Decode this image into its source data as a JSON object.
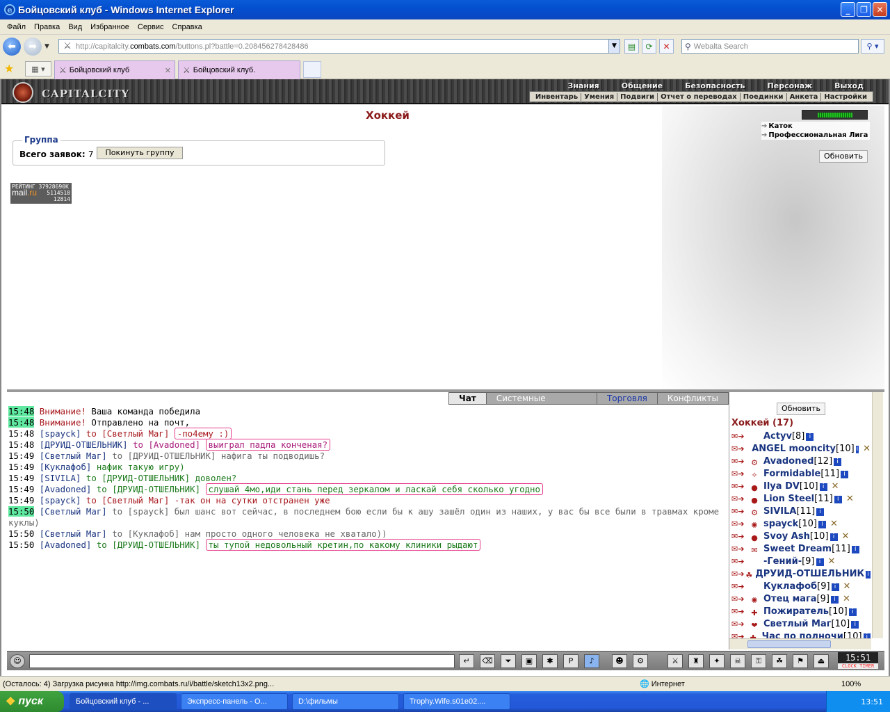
{
  "window": {
    "title": "Бойцовский клуб - Windows Internet Explorer"
  },
  "menu": [
    "Файл",
    "Правка",
    "Вид",
    "Избранное",
    "Сервис",
    "Справка"
  ],
  "address": {
    "host_prefix": "http://capitalcity.",
    "host": "combats.com",
    "path": "/buttons.pl?battle=0.208456278428486"
  },
  "search": {
    "placeholder": "Webalta Search"
  },
  "tabs": [
    {
      "label": "Бойцовский клуб"
    },
    {
      "label": "Бойцовский клуб."
    }
  ],
  "game": {
    "brand": "CAPITALCITY",
    "topnav": [
      "Знания",
      "Общение",
      "Безопасность",
      "Персонаж",
      "Выход"
    ],
    "subnav": [
      "Инвентарь",
      "Умения",
      "Подвиги",
      "Отчет о переводах",
      "Поединки",
      "Анкета",
      "Настройки"
    ],
    "title": "Хоккей",
    "group_label": "Группа",
    "total_label": "Всего заявок:",
    "total_count": "7",
    "leave_button": "Покинуть группу",
    "rating": {
      "line1": "РЕЙТИНГ 37928690К",
      "line2": "5114518",
      "line3": "12814",
      "mail": "mail",
      "ru": ".ru"
    },
    "energy_fraction": 0.72,
    "links": [
      "Каток",
      "Профессиональная Лига"
    ],
    "refresh": "Обновить"
  },
  "chat": {
    "tabs": [
      "Чат",
      "Системные сообщения",
      "Торговля",
      "Конфликты"
    ],
    "lines": [
      {
        "ts": "15:48",
        "hl": true,
        "parts": [
          {
            "t": "Внимание!",
            "c": "warn"
          },
          {
            "t": " Ваша команда победила",
            "c": ""
          }
        ]
      },
      {
        "ts": "15:48",
        "hl": true,
        "parts": [
          {
            "t": "Внимание!",
            "c": "warn"
          },
          {
            "t": " Отправлено на почт,",
            "c": ""
          }
        ]
      },
      {
        "ts": "15:48",
        "hl": false,
        "parts": [
          {
            "t": "[spayck]",
            "c": "nm"
          },
          {
            "t": " to [Светлый Маг] ",
            "c": "warn"
          },
          {
            "t": "-по4ему :)",
            "c": "warn circled"
          }
        ]
      },
      {
        "ts": "15:48",
        "hl": false,
        "parts": [
          {
            "t": "[ДРУИД-ОТШЕЛЬНИК]",
            "c": "nm"
          },
          {
            "t": " to [Avadoned] ",
            "c": "to"
          },
          {
            "t": "выиграл падла конченая?",
            "c": "to circled"
          }
        ]
      },
      {
        "ts": "15:49",
        "hl": false,
        "parts": [
          {
            "t": "[Светлый Маг]",
            "c": "nm"
          },
          {
            "t": " to [ДРУИД-ОТШЕЛЬНИК] нафига ты подводишь?",
            "c": "grey"
          }
        ]
      },
      {
        "ts": "15:49",
        "hl": false,
        "parts": [
          {
            "t": "[Куклафоб]",
            "c": "nm"
          },
          {
            "t": " нафик такую игру)",
            "c": "green"
          }
        ]
      },
      {
        "ts": "15:49",
        "hl": false,
        "parts": [
          {
            "t": "[SIVILA]",
            "c": "nm"
          },
          {
            "t": " to [ДРУИД-ОТШЕЛЬНИК] доволен?",
            "c": "green"
          }
        ]
      },
      {
        "ts": "15:49",
        "hl": false,
        "parts": [
          {
            "t": "[Avadoned]",
            "c": "nm"
          },
          {
            "t": " to [ДРУИД-ОТШЕЛЬНИК] ",
            "c": "green"
          },
          {
            "t": "слушай 4мо,иди стань перед зеркалом и ласкай себя сколько угодно",
            "c": "green circled"
          }
        ]
      },
      {
        "ts": "15:49",
        "hl": false,
        "parts": [
          {
            "t": "[spayck]",
            "c": "nm"
          },
          {
            "t": " to [Светлый Маг] -так он на сутки отстранен уже",
            "c": "warn"
          }
        ]
      },
      {
        "ts": "15:50",
        "hl": true,
        "wrap": true,
        "parts": [
          {
            "t": "[Светлый Маг]",
            "c": "nm"
          },
          {
            "t": " to [spayck]",
            "c": "grey"
          },
          {
            "t": " был шанс вот сейчас, в последнем бою если бы к ашу зашёл один из наших, у вас бы все были в травмах кроме куклы)",
            "c": "grey"
          }
        ]
      },
      {
        "ts": "15:50",
        "hl": false,
        "parts": [
          {
            "t": "[Светлый Маг]",
            "c": "nm"
          },
          {
            "t": " to [Куклафоб] нам просто одного человека не хватало))",
            "c": "grey"
          }
        ]
      },
      {
        "ts": "15:50",
        "hl": false,
        "parts": [
          {
            "t": "[Avadoned]",
            "c": "nm"
          },
          {
            "t": " to [ДРУИД-ОТШЕЛЬНИК] ",
            "c": "green"
          },
          {
            "t": "ты тупой недовольный кретин,по какому клиники рыдают",
            "c": "green circled"
          }
        ]
      }
    ]
  },
  "users": {
    "refresh": "Обновить",
    "room": "Хоккей (17)",
    "list": [
      {
        "name": "Actyv",
        "lvl": "[8]",
        "cross": false
      },
      {
        "name": "ANGEL mooncity",
        "lvl": "[10]",
        "cross": true
      },
      {
        "name": "Avadoned",
        "lvl": "[12]",
        "cross": false
      },
      {
        "name": "Formidable",
        "lvl": "[11]",
        "cross": false
      },
      {
        "name": "Ilya DV",
        "lvl": "[10]",
        "cross": true
      },
      {
        "name": "Lion Steel",
        "lvl": "[11]",
        "cross": true
      },
      {
        "name": "SIVILA",
        "lvl": "[11]",
        "cross": false
      },
      {
        "name": "spayck",
        "lvl": "[10]",
        "cross": true
      },
      {
        "name": "Svoy Ash",
        "lvl": "[10]",
        "cross": true
      },
      {
        "name": "Sweet Dream",
        "lvl": "[11]",
        "cross": false
      },
      {
        "name": "-Гений-",
        "lvl": "[9]",
        "cross": true
      },
      {
        "name": "ДРУИД-ОТШЕЛЬНИК",
        "lvl": "",
        "cross": false
      },
      {
        "name": "Куклафоб",
        "lvl": "[9]",
        "cross": true
      },
      {
        "name": "Отец мага",
        "lvl": "[9]",
        "cross": true
      },
      {
        "name": "Пожиратель",
        "lvl": "[10]",
        "cross": false
      },
      {
        "name": "Светлый Маг",
        "lvl": "[10]",
        "cross": false
      },
      {
        "name": "Час по полночи",
        "lvl": "[10]",
        "cross": false
      }
    ]
  },
  "clock": {
    "time": "15:51",
    "label": "CLOCK TIMER"
  },
  "status": {
    "text": "(Осталось: 4) Загрузка рисунка http://img.combats.ru/i/battle/sketch13x2.png...",
    "zone": "Интернет",
    "zoom": "100%"
  },
  "taskbar": {
    "start": "пуск",
    "tasks": [
      "Бойцовский клуб - ...",
      "Экспресс-панель - О...",
      "D:\\фильмы",
      "Trophy.Wife.s01e02...."
    ],
    "time": "13:51"
  }
}
